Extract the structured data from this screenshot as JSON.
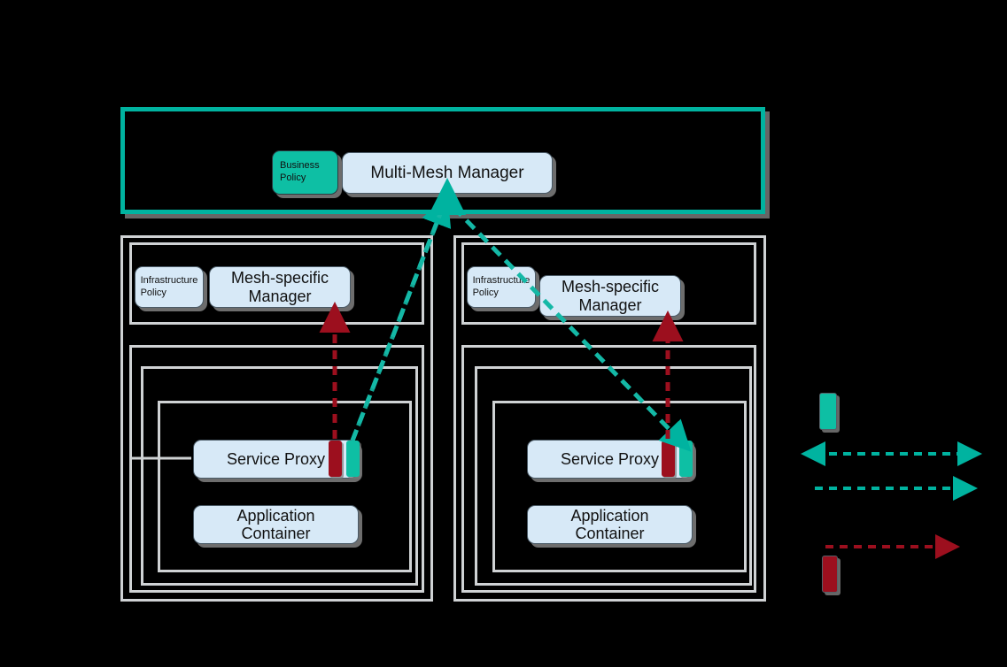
{
  "diagram": {
    "title": "",
    "colors": {
      "background": "#000000",
      "teal": "#00b3a0",
      "teal_fill": "#0ebfa4",
      "node_fill": "#d7e9f7",
      "node_border": "#4a5a66",
      "panel_border": "#cfd2d4",
      "red": "#9c0f1e",
      "shadow": "#808080"
    }
  },
  "control_plane": {
    "name": "control-plane",
    "business_policy": {
      "label": "Business\nPolicy"
    },
    "manager": {
      "label": "Multi-Mesh Manager"
    }
  },
  "meshes": [
    {
      "id": "mesh-left",
      "infrastructure_policy": {
        "label": "Infrastructure\nPolicy"
      },
      "mesh_manager": {
        "label": "Mesh-specific\nManager"
      },
      "service_proxy": {
        "label": "Service Proxy"
      },
      "application_container": {
        "label": "Application Container"
      }
    },
    {
      "id": "mesh-right",
      "infrastructure_policy": {
        "label": "Infrastructure\nPolicy"
      },
      "mesh_manager": {
        "label": "Mesh-specific\nManager"
      },
      "service_proxy": {
        "label": "Service Proxy"
      },
      "application_container": {
        "label": "Application Container"
      }
    }
  ],
  "legend": {
    "items": [
      {
        "id": "legend-teal-swatch",
        "type": "swatch",
        "color": "#0ebfa4",
        "label": ""
      },
      {
        "id": "legend-bidirectional-teal",
        "type": "arrow-bidirectional",
        "color": "#00b3a0",
        "label": ""
      },
      {
        "id": "legend-unidirectional-teal",
        "type": "arrow-right",
        "color": "#00b3a0",
        "label": ""
      },
      {
        "id": "legend-unidirectional-red",
        "type": "arrow-right",
        "color": "#9c0f1e",
        "label": ""
      },
      {
        "id": "legend-red-swatch",
        "type": "swatch",
        "color": "#9c0f1e",
        "label": ""
      }
    ]
  }
}
